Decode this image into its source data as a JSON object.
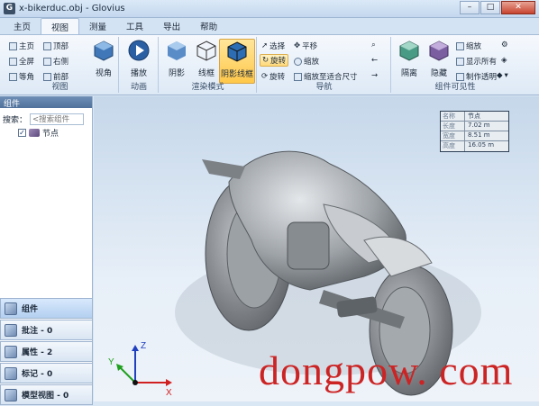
{
  "window": {
    "app_icon": "G",
    "title": "x-bikerduc.obj - Glovius",
    "minimize": "–",
    "maximize": "□",
    "close": "✕"
  },
  "menu_tabs": [
    {
      "label": "主页"
    },
    {
      "label": "视图"
    },
    {
      "label": "测量"
    },
    {
      "label": "工具"
    },
    {
      "label": "导出"
    },
    {
      "label": "帮助"
    }
  ],
  "active_tab": "视图",
  "ribbon": {
    "view_group": {
      "label": "视图",
      "buttons": [
        "主页",
        "顶部",
        "全屏",
        "右侧",
        "等角",
        "前部"
      ],
      "big_button": "视角"
    },
    "animation_group": {
      "label": "动画",
      "big_button": "播放"
    },
    "render_group": {
      "label": "渲染模式",
      "buttons": [
        "阴影",
        "线框",
        "阴影线框"
      ],
      "selected": "阴影线框"
    },
    "navigation_group": {
      "label": "导航",
      "buttons": [
        "选择",
        "平移",
        "旋转",
        "缩放",
        "旋转",
        "缩放至适合尺寸"
      ],
      "selected": "旋转"
    },
    "visibility_group": {
      "label": "组件可见性",
      "big_buttons": [
        "隔离",
        "隐藏"
      ],
      "buttons": [
        "缩放",
        "显示所有",
        "制作透明"
      ]
    }
  },
  "left_panel": {
    "title": "组件",
    "search_label": "搜索：",
    "search_placeholder": "<搜索组件",
    "tree": [
      {
        "label": "节点",
        "checked": true
      }
    ],
    "bottom_tabs": [
      {
        "label": "组件",
        "active": true
      },
      {
        "label": "批注 - 0"
      },
      {
        "label": "属性 - 2"
      },
      {
        "label": "标记 - 0"
      },
      {
        "label": "模型视图 - 0"
      }
    ]
  },
  "viewport": {
    "info_table": [
      {
        "key": "名称",
        "value": "节点"
      },
      {
        "key": "长度",
        "value": "7.02 m"
      },
      {
        "key": "宽度",
        "value": "8.51 m"
      },
      {
        "key": "高度",
        "value": "16.05 m"
      }
    ],
    "axes": {
      "x": "X",
      "y": "Y",
      "z": "Z"
    },
    "watermark": "dongpow. com"
  },
  "colors": {
    "accent": "#4f719b",
    "selected": "#ffc84a",
    "x_axis": "#d02020",
    "y_axis": "#20a020",
    "z_axis": "#2040c0",
    "watermark": "#cc2424"
  }
}
